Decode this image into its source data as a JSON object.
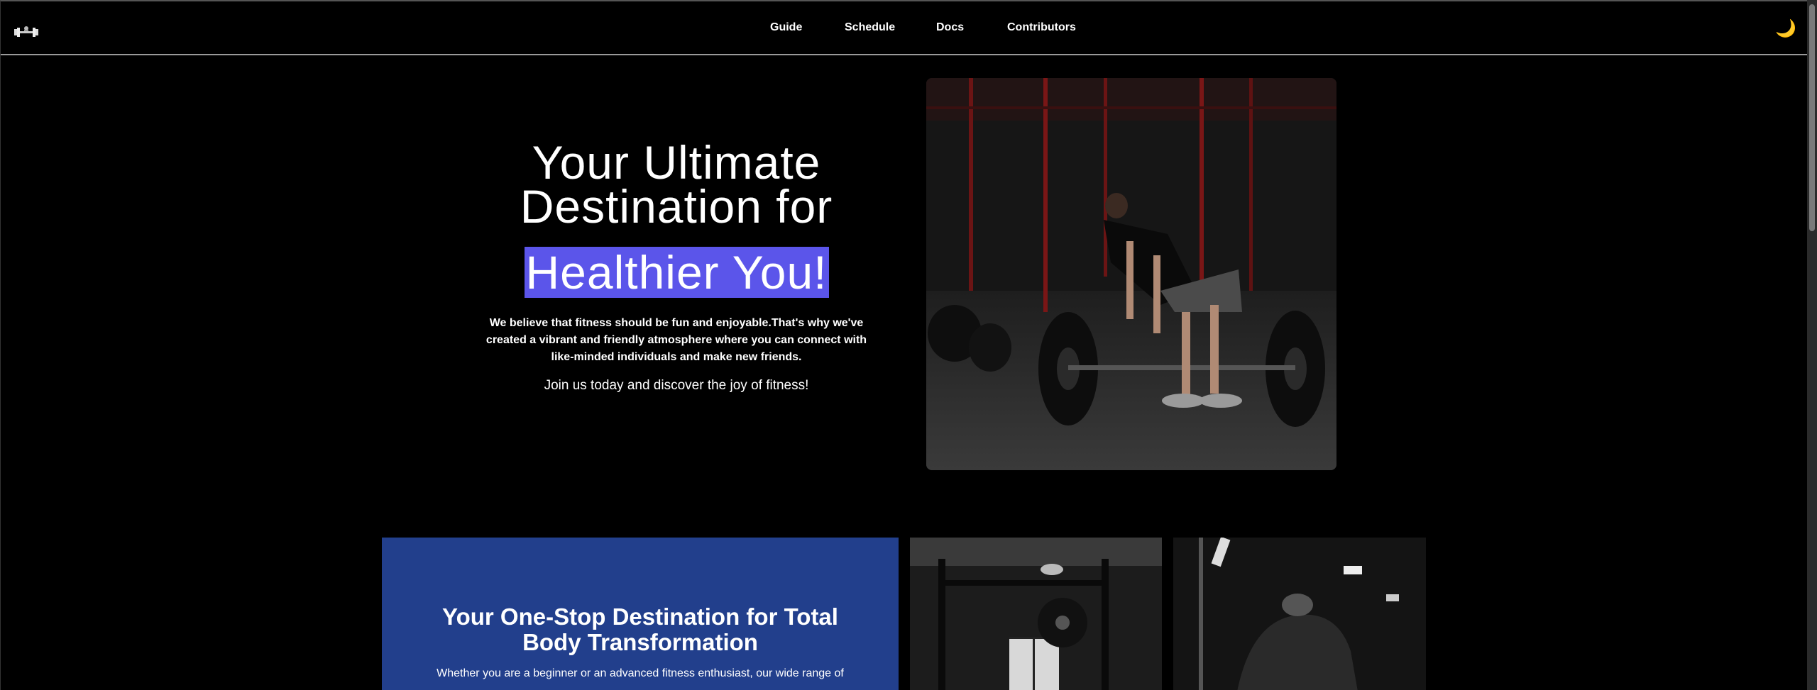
{
  "header": {
    "logo_icon": "dumbbell-logo-icon",
    "nav": [
      {
        "label": "Guide"
      },
      {
        "label": "Schedule"
      },
      {
        "label": "Docs"
      },
      {
        "label": "Contributors"
      }
    ],
    "theme_toggle": {
      "icon": "moon-icon",
      "glyph": "🌙"
    }
  },
  "hero": {
    "title": "Your Ultimate Destination for",
    "highlight": "Healthier You!",
    "description": "We believe that fitness should be fun and enjoyable.That's why we've created a vibrant and friendly atmosphere where you can connect with like-minded individuals and make new friends.",
    "join": "Join us today and discover the joy of fitness!",
    "accent_color": "#5b55ea"
  },
  "promo": {
    "title": "Your One-Stop Destination for Total Body Transformation",
    "text": "Whether you are a beginner or an advanced fitness enthusiast, our wide range of",
    "bg_color": "#223f8c"
  }
}
